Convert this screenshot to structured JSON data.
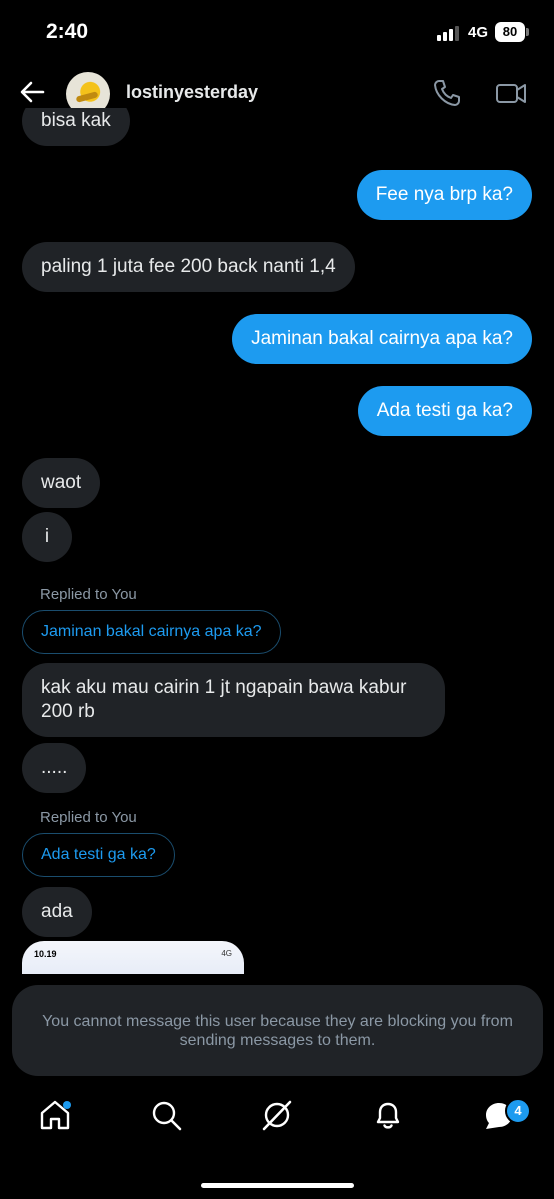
{
  "status": {
    "time": "2:40",
    "network": "4G",
    "battery": "80"
  },
  "header": {
    "username": "lostinyesterday"
  },
  "messages": {
    "m0": "bisa kak",
    "m1": "Fee nya brp ka?",
    "m2": "paling 1 juta fee 200 back nanti 1,4",
    "m3": "Jaminan bakal cairnya apa ka?",
    "m4": "Ada testi ga ka?",
    "m5": "waot",
    "m6": "i",
    "reply1_label": "Replied to You",
    "reply1_quote": "Jaminan bakal cairnya apa ka?",
    "m7": "kak aku mau cairin 1 jt ngapain bawa kabur 200 rb",
    "m8": ".....",
    "reply2_label": "Replied to You",
    "reply2_quote": "Ada testi ga ka?",
    "m9": "ada",
    "thumb_time": "10.19",
    "thumb_status": "4G"
  },
  "blocked_notice": "You cannot message this user because they are blocking you from sending messages to them.",
  "tabbar": {
    "messages_badge": "4"
  },
  "colors": {
    "accent": "#1d9bf0",
    "incoming_bubble": "#202327",
    "background": "#000000"
  }
}
